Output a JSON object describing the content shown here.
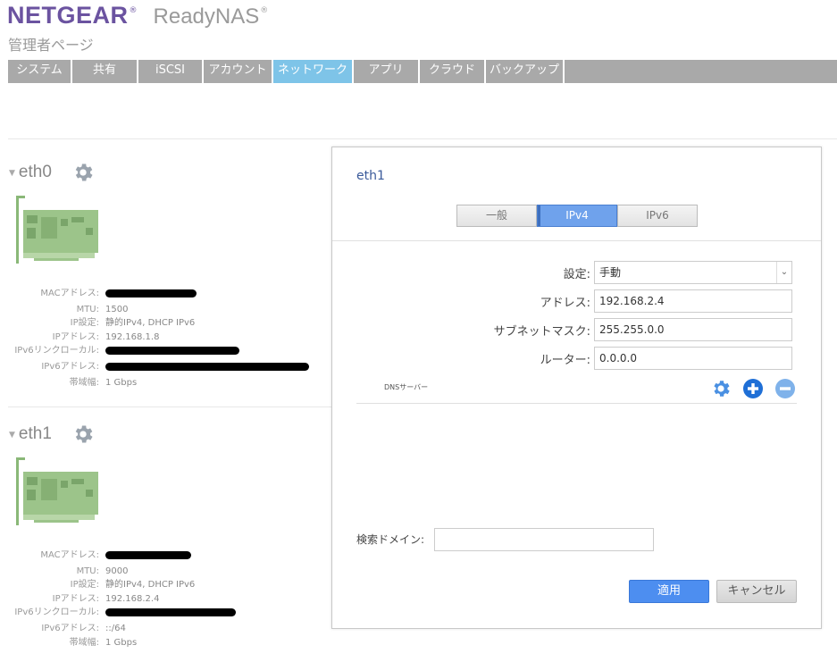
{
  "header": {
    "brand": "NETGEAR",
    "brand_mark": "®",
    "product": "ReadyNAS",
    "product_mark": "®",
    "subtitle": "管理者ページ"
  },
  "tabs": [
    {
      "label": "システム",
      "active": false
    },
    {
      "label": "共有",
      "active": false
    },
    {
      "label": "iSCSI",
      "active": false
    },
    {
      "label": "アカウント",
      "active": false
    },
    {
      "label": "ネットワーク",
      "active": true
    },
    {
      "label": "アプリ",
      "active": false
    },
    {
      "label": "クラウド",
      "active": false
    },
    {
      "label": "バックアップ",
      "active": false
    }
  ],
  "interfaces": [
    {
      "name": "eth0",
      "gear_icon": "gear-icon",
      "props": {
        "mac_label": "MACアドレス:",
        "mtu_label": "MTU:",
        "mtu_value": "1500",
        "ipconf_label": "IP設定:",
        "ipconf_value": "静的IPv4, DHCP IPv6",
        "ip_label": "IPアドレス:",
        "ip_value": "192.168.1.8",
        "ipv6link_label": "IPv6リンクローカル:",
        "ipv6_label": "IPv6アドレス:",
        "ipv6_value": "",
        "bw_label": "帯域幅:",
        "bw_value": "1 Gbps"
      }
    },
    {
      "name": "eth1",
      "gear_icon": "gear-icon",
      "props": {
        "mac_label": "MACアドレス:",
        "mtu_label": "MTU:",
        "mtu_value": "9000",
        "ipconf_label": "IP設定:",
        "ipconf_value": "静的IPv4, DHCP IPv6",
        "ip_label": "IPアドレス:",
        "ip_value": "192.168.2.4",
        "ipv6link_label": "IPv6リンクローカル:",
        "ipv6_label": "IPv6アドレス:",
        "ipv6_value": "::/64",
        "bw_label": "帯域幅:",
        "bw_value": "1 Gbps"
      }
    }
  ],
  "panel": {
    "title": "eth1",
    "segments": [
      {
        "label": "一般",
        "active": false
      },
      {
        "label": "IPv4",
        "active": true
      },
      {
        "label": "IPv6",
        "active": false
      }
    ],
    "fields": {
      "setting_label": "設定:",
      "setting_value": "手動",
      "address_label": "アドレス:",
      "address_value": "192.168.2.4",
      "subnet_label": "サブネットマスク:",
      "subnet_value": "255.255.0.0",
      "router_label": "ルーター:",
      "router_value": "0.0.0.0"
    },
    "dns_label": "DNSサーバー",
    "dns_icons": [
      "gear-icon",
      "plus-circle-icon",
      "minus-circle-icon"
    ],
    "search_domain_label": "検索ドメイン:",
    "search_domain_value": "",
    "apply_label": "適用",
    "cancel_label": "キャンセル"
  },
  "colors": {
    "brand": "#6b53a0",
    "tab_bar": "#a9a9a9",
    "tab_active": "#7ec4e8",
    "segment_active": "#6fa2ec",
    "apply_button": "#4d8ef0",
    "icon_blue": "#3a84d8",
    "nic_green": "#9cc48a"
  }
}
